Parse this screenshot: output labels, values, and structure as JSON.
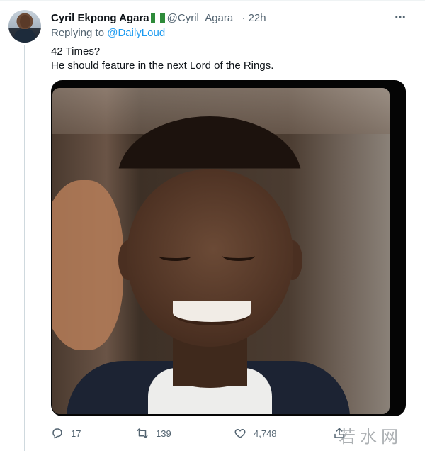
{
  "tweet": {
    "author_name": "Cyril Ekpong Agara",
    "handle": "@Cyril_Agara_",
    "separator": "·",
    "time": "22h",
    "replying_prefix": "Replying to",
    "replying_to": "@DailyLoud",
    "text_line1": "42 Times?",
    "text_line2": "He should feature in the next Lord of the Rings.",
    "flag_colors": [
      "#2e8b3a",
      "#ffffff",
      "#2e8b3a"
    ]
  },
  "actions": {
    "reply_count": "17",
    "retweet_count": "139",
    "like_count": "4,748"
  },
  "icons": {
    "more": "more-icon",
    "reply": "reply-icon",
    "retweet": "retweet-icon",
    "like": "heart-icon",
    "share": "share-icon"
  },
  "watermark": {
    "text": "若水网"
  },
  "colors": {
    "link": "#1d9bf0",
    "secondary_text": "#536471",
    "primary_text": "#0f1419"
  }
}
